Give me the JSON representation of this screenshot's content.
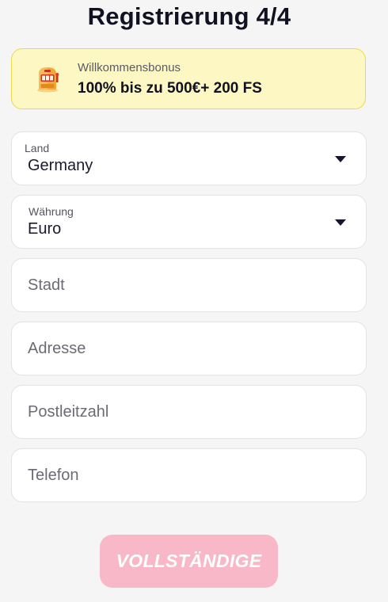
{
  "header": {
    "title": "Registrierung 4/4"
  },
  "bonus": {
    "icon": "slot-machine-icon",
    "subtitle": "Willkommensbonus",
    "text": "100% bis zu 500€+ 200 FS"
  },
  "form": {
    "country": {
      "label": "Land",
      "value": "Germany"
    },
    "currency": {
      "label": "Währung",
      "value": "Euro"
    },
    "city": {
      "placeholder": "Stadt"
    },
    "address": {
      "placeholder": "Adresse"
    },
    "postcode": {
      "placeholder": "Postleitzahl"
    },
    "phone": {
      "placeholder": "Telefon"
    }
  },
  "actions": {
    "submit_label": "VOLLSTÄNDIGE"
  },
  "colors": {
    "background": "#f5f5f5",
    "bonus_background": "#fdf7c3",
    "bonus_border": "#ecd94a",
    "submit_button": "#f8b8c8"
  }
}
